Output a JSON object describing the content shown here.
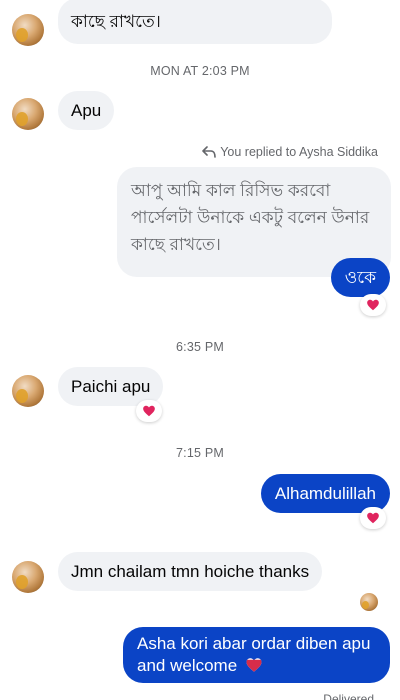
{
  "messages": {
    "m0_text": "কাছে রাখতে।",
    "ts1": "MON AT 2:03 PM",
    "m1_text": "Apu",
    "reply_note": "You replied to Aysha Siddika",
    "quoted_line1": "আপু আমি কাল রিসিভ করবো",
    "quoted_line2": "পার্সেলটা উনাকে একটু বলেন উনার",
    "quoted_line3": "কাছে রাখতে।",
    "m2_text": "ওকে",
    "ts2": "6:35 PM",
    "m3_text": "Paichi apu",
    "ts3": "7:15 PM",
    "m4_text": "Alhamdulillah",
    "m5_text": "Jmn chailam tmn hoiche thanks",
    "m6_line1": "Asha kori abar ordar diben apu",
    "m6_line2": "and welcome",
    "delivered": "Delivered"
  },
  "reaction_icon": "heart-icon",
  "colors": {
    "outgoing_bubble": "#0b44c6",
    "incoming_bubble": "#f0f2f5",
    "meta_text": "#65676b",
    "heart": "#e0245e"
  }
}
